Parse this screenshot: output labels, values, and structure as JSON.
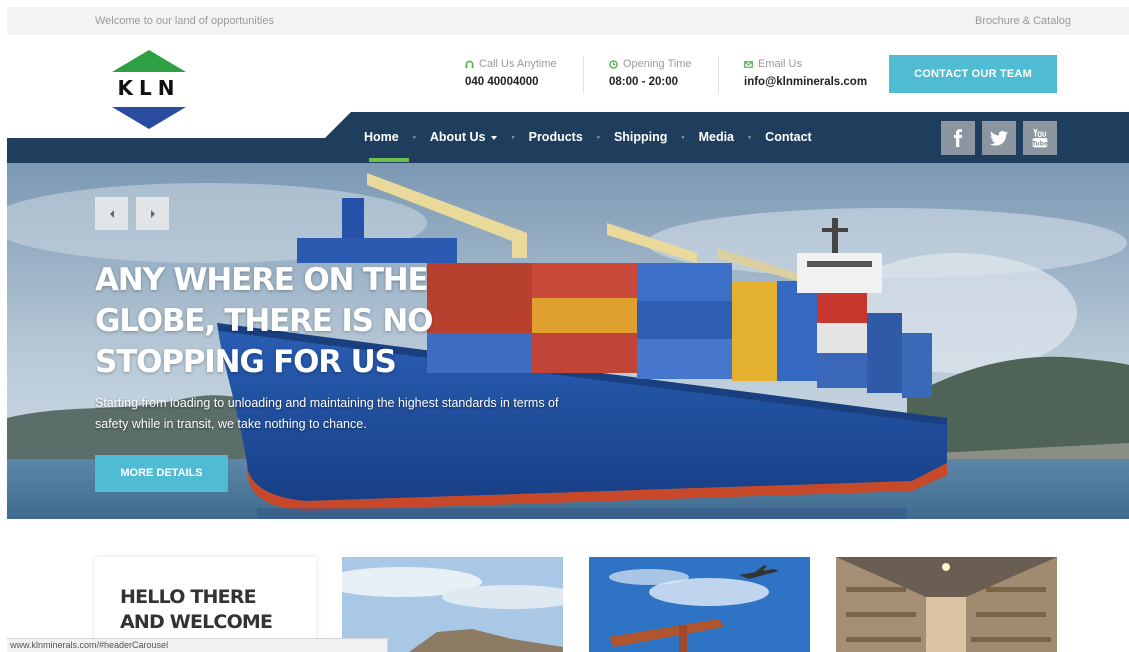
{
  "topbar": {
    "welcome": "Welcome to our land of opportunities",
    "brochure": "Brochure & Catalog"
  },
  "logo": {
    "text": "KLN",
    "colors": {
      "top": "#2ea043",
      "bottom": "#2b4c9e"
    }
  },
  "contact": {
    "phone": {
      "label": "Call Us Anytime",
      "value": "040 40004000",
      "icon": "headset-icon"
    },
    "hours": {
      "label": "Opening Time",
      "value": "08:00 - 20:00",
      "icon": "clock-icon"
    },
    "email": {
      "label": "Email Us",
      "value": "info@klnminerals.com",
      "icon": "envelope-icon"
    },
    "cta_label": "CONTACT OUR TEAM"
  },
  "nav": {
    "items": [
      "Home",
      "About Us",
      "Products",
      "Shipping",
      "Media",
      "Contact"
    ],
    "active": "Home"
  },
  "social": [
    "facebook-icon",
    "twitter-icon",
    "youtube-icon"
  ],
  "hero": {
    "headline": "ANY WHERE ON THE GLOBE, THERE IS NO STOPPING FOR US",
    "subtext": "Starting from loading to unloading and maintaining the highest standards in terms of safety while in transit, we take nothing to chance.",
    "button_label": "MORE DETAILS"
  },
  "cards": {
    "hello_title": "HELLO THERE AND WELCOME"
  },
  "statusbar": {
    "url": "www.klnminerals.com/#headerCarousel"
  },
  "colors": {
    "accent": "#4fbcd3",
    "navy": "#1f3d5c",
    "active_underline": "#6cbf4a",
    "social_bg": "#8b96a1"
  }
}
